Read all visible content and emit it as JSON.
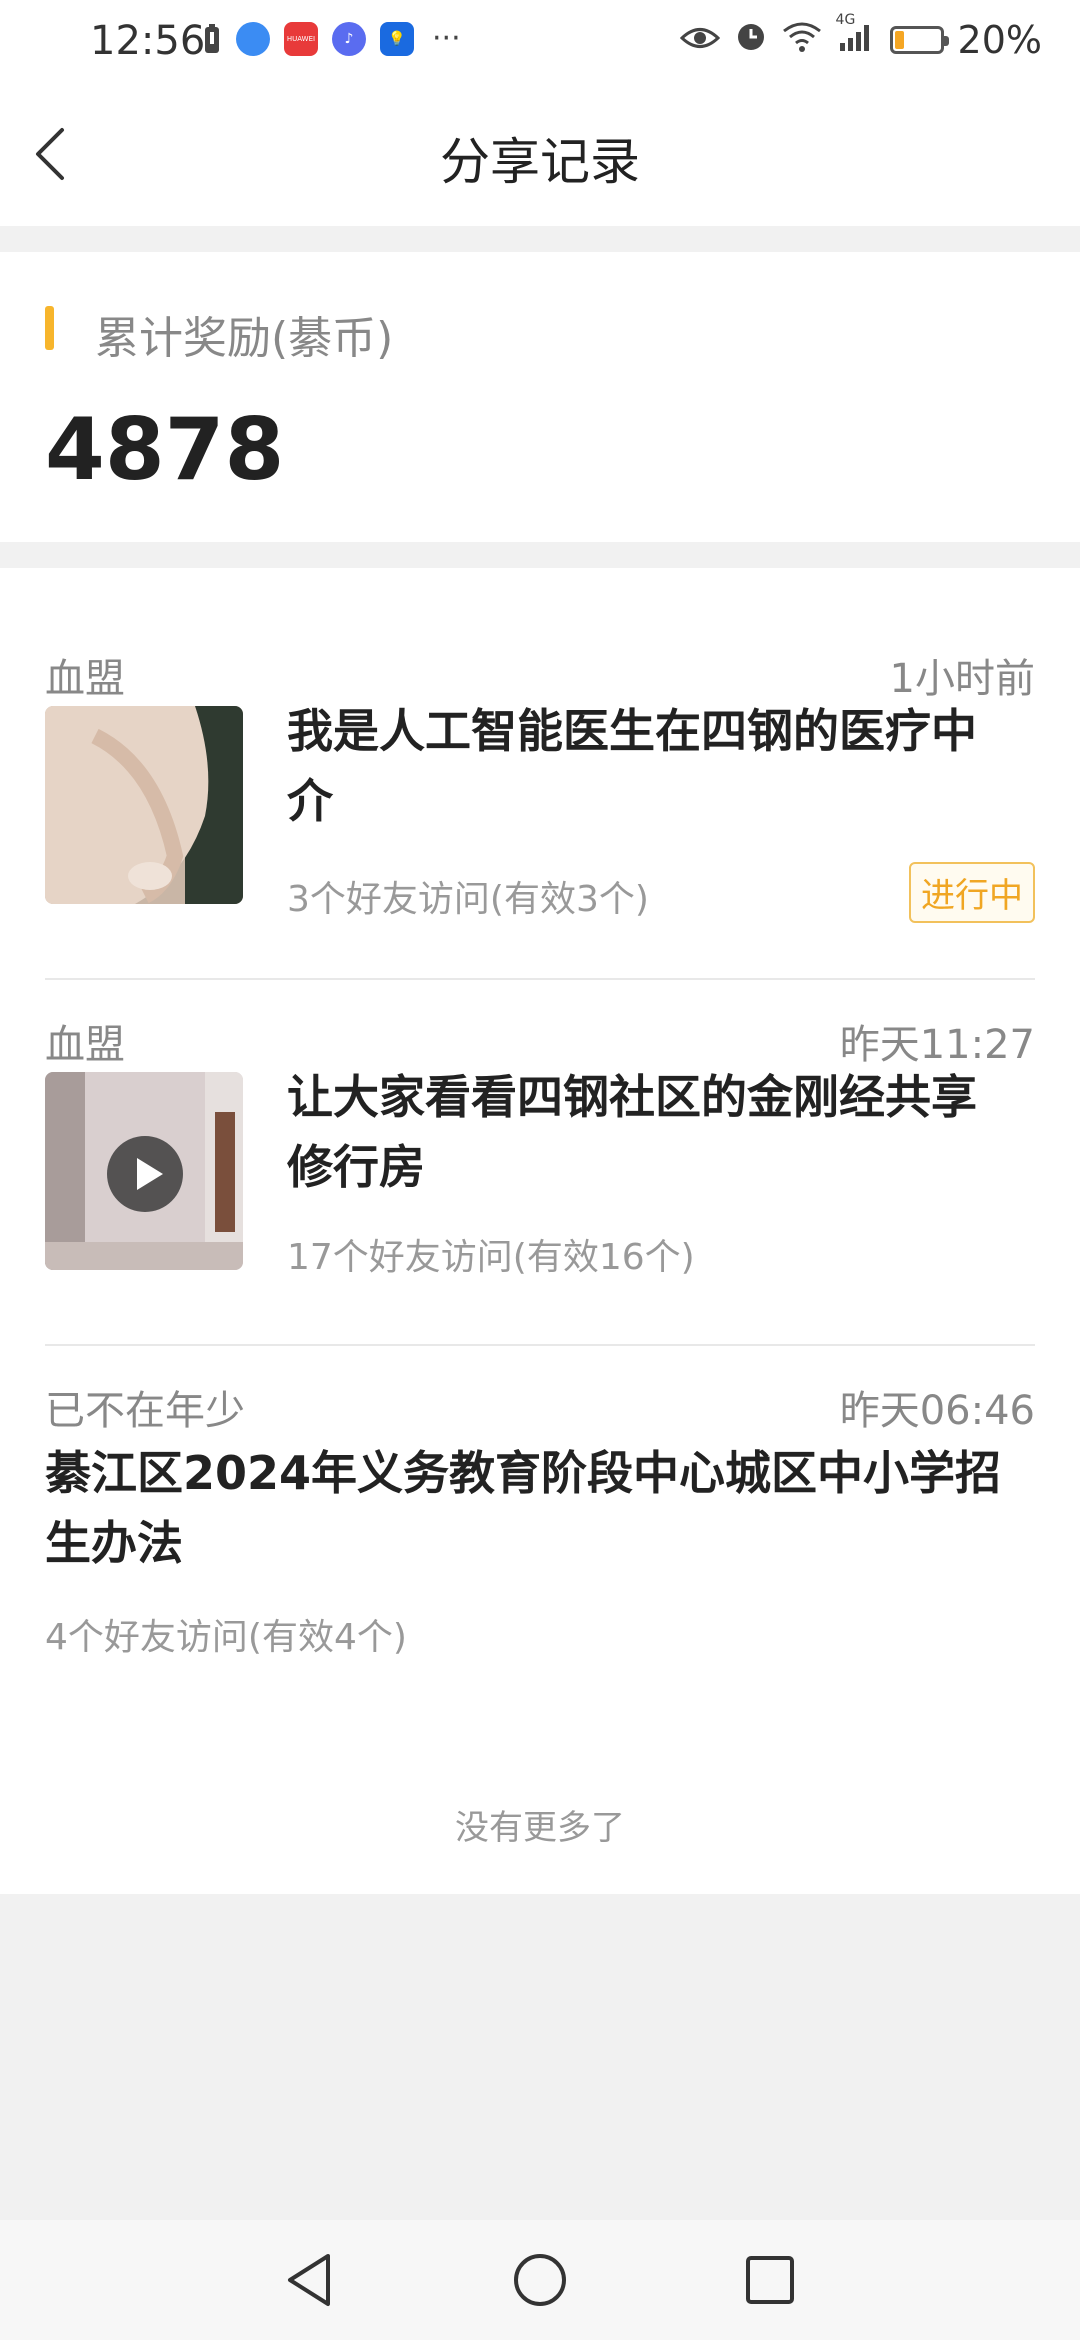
{
  "status_bar": {
    "time": "12:56",
    "battery_percent": "20%",
    "battery_level": 0.2,
    "network": "4G",
    "left_icons": [
      "battery-saver-icon",
      "browser-icon",
      "huawei-store-icon",
      "music-icon",
      "tips-icon"
    ],
    "right_icons": [
      "eye-icon",
      "alarm-icon",
      "wifi-icon",
      "signal-icon",
      "battery-icon"
    ],
    "more": "···",
    "huawei_label": "HUAWEI"
  },
  "header": {
    "title": "分享记录"
  },
  "reward": {
    "label": "累计奖励(綦币)",
    "value": "4878"
  },
  "records": [
    {
      "author": "血盟",
      "time": "1小时前",
      "title_line1": "我是人工智能医生在四钢的医疗中",
      "title_line2": "介",
      "visits": "3个好友访问(有效3个)",
      "status": "进行中",
      "has_thumb": true,
      "thumb_type": "image"
    },
    {
      "author": "血盟",
      "time": "昨天11:27",
      "title_line1": "让大家看看四钢社区的金刚经共享",
      "title_line2": "修行房",
      "visits": "17个好友访问(有效16个)",
      "has_thumb": true,
      "thumb_type": "video"
    },
    {
      "author": "已不在年少",
      "time": "昨天06:46",
      "title_line1": "綦江区2024年义务教育阶段中心城区中小学招",
      "title_line2": "生办法",
      "visits": "4个好友访问(有效4个)",
      "has_thumb": false
    }
  ],
  "footer_text": "没有更多了",
  "colors": {
    "accent": "#f7b52c",
    "status_badge": "#f0a623",
    "background": "#f1f1f1"
  }
}
